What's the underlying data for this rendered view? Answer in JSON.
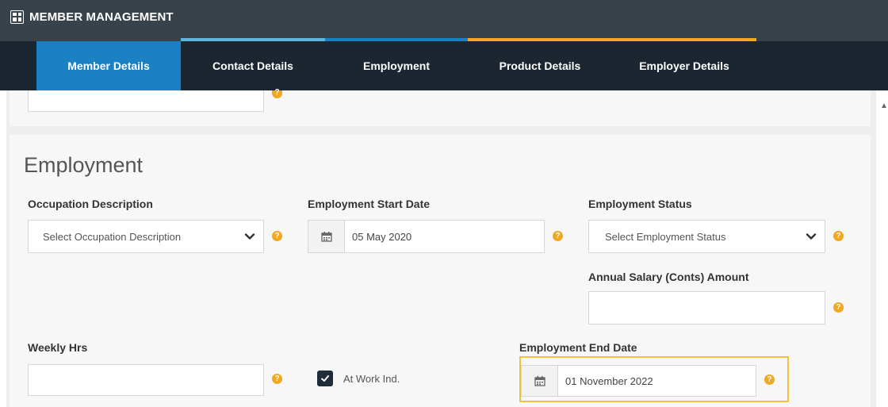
{
  "header": {
    "app_title": "MEMBER MANAGEMENT",
    "app_icon": "grid-icon"
  },
  "tabs": [
    {
      "label": "Member Details",
      "active": true
    },
    {
      "label": "Contact Details",
      "active": false
    },
    {
      "label": "Employment",
      "active": false
    },
    {
      "label": "Product Details",
      "active": false
    },
    {
      "label": "Employer Details",
      "active": false
    }
  ],
  "tab_accent_colors": [
    "#5fb4de",
    "#1a82c4",
    "#f0a820",
    "#f0a820"
  ],
  "colors": {
    "header_bg": "#38424b",
    "tabbar_bg": "#1b2630",
    "active_tab": "#1a82c4",
    "help_icon": "#f0a820",
    "highlight_border": "#f2c23a"
  },
  "employment": {
    "section_title": "Employment",
    "occupation": {
      "label": "Occupation Description",
      "value": "Select Occupation Description"
    },
    "start_date": {
      "label": "Employment Start Date",
      "value": "05 May 2020"
    },
    "status": {
      "label": "Employment Status",
      "value": "Select Employment Status"
    },
    "annual_salary": {
      "label": "Annual Salary (Conts) Amount",
      "value": ""
    },
    "weekly_hrs": {
      "label": "Weekly Hrs",
      "value": ""
    },
    "at_work": {
      "label": "At Work Ind.",
      "checked": true
    },
    "end_date": {
      "label": "Employment End Date",
      "value": "01 November 2022"
    }
  },
  "icons": {
    "help": "question-circle-icon",
    "calendar": "calendar-icon",
    "dropdown": "chevron-down-icon",
    "check": "check-icon"
  }
}
